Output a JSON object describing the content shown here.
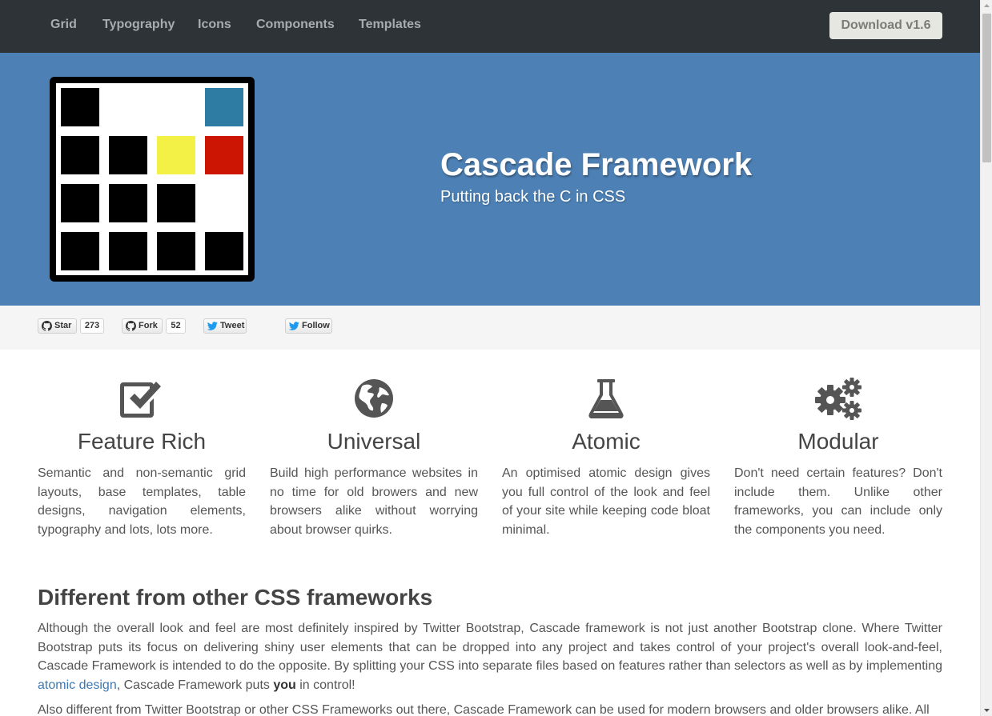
{
  "navbar": {
    "items": [
      {
        "label": "Grid"
      },
      {
        "label": "Typography"
      },
      {
        "label": "Icons"
      },
      {
        "label": "Components"
      },
      {
        "label": "Templates"
      }
    ],
    "download_label": "Download v1.6"
  },
  "hero": {
    "title": "Cascade Framework",
    "subtitle": "Putting back the C in CSS",
    "logo_colors": {
      "frame": "#000000",
      "blue": "#2e7ba3",
      "yellow": "#f3f145",
      "red": "#cd1503"
    }
  },
  "social": {
    "star": {
      "label": "Star",
      "count": "273"
    },
    "fork": {
      "label": "Fork",
      "count": "52"
    },
    "tweet": {
      "label": "Tweet"
    },
    "follow": {
      "label": "Follow"
    }
  },
  "features": [
    {
      "icon": "checkbox-icon",
      "title": "Feature Rich",
      "text": "Semantic and non-semantic grid layouts, base templates, table designs, navigation elements, typography and lots, lots more."
    },
    {
      "icon": "globe-icon",
      "title": "Universal",
      "text": "Build high performance websites in no time for old browers and new browsers alike without worrying about browser quirks."
    },
    {
      "icon": "flask-icon",
      "title": "Atomic",
      "text": "An optimised atomic design gives you full control of the look and feel of your site while keeping code bloat minimal."
    },
    {
      "icon": "gears-icon",
      "title": "Modular",
      "text": "Don't need certain features? Don't include them. Unlike other frameworks, you can include only the components you need."
    }
  ],
  "section": {
    "title": "Different from other CSS frameworks",
    "para1_before": "Although the overall look and feel are most definitely inspired by Twitter Bootstrap, Cascade framework is not just another Bootstrap clone. Where Twitter Bootstrap puts its focus on delivering shiny user elements that can be dropped into any project and takes control of your project's overall look-and-feel, Cascade Framework is intended to do the opposite. By splitting your CSS into separate files based on features rather than selectors as well as by implementing ",
    "para1_link": "atomic design",
    "para1_mid": ", Cascade Framework puts ",
    "para1_bold": "you",
    "para1_after": " in control!",
    "para2": "Also different from Twitter Bootstrap or other CSS Frameworks out there, Cascade Framework can be used for modern browsers and older browsers alike. All"
  },
  "colors": {
    "navbar_bg": "#2d3337",
    "hero_bg": "#4d81b5",
    "social_bg": "#f5f5f5",
    "icon": "#555555",
    "link": "#3e78b2"
  }
}
